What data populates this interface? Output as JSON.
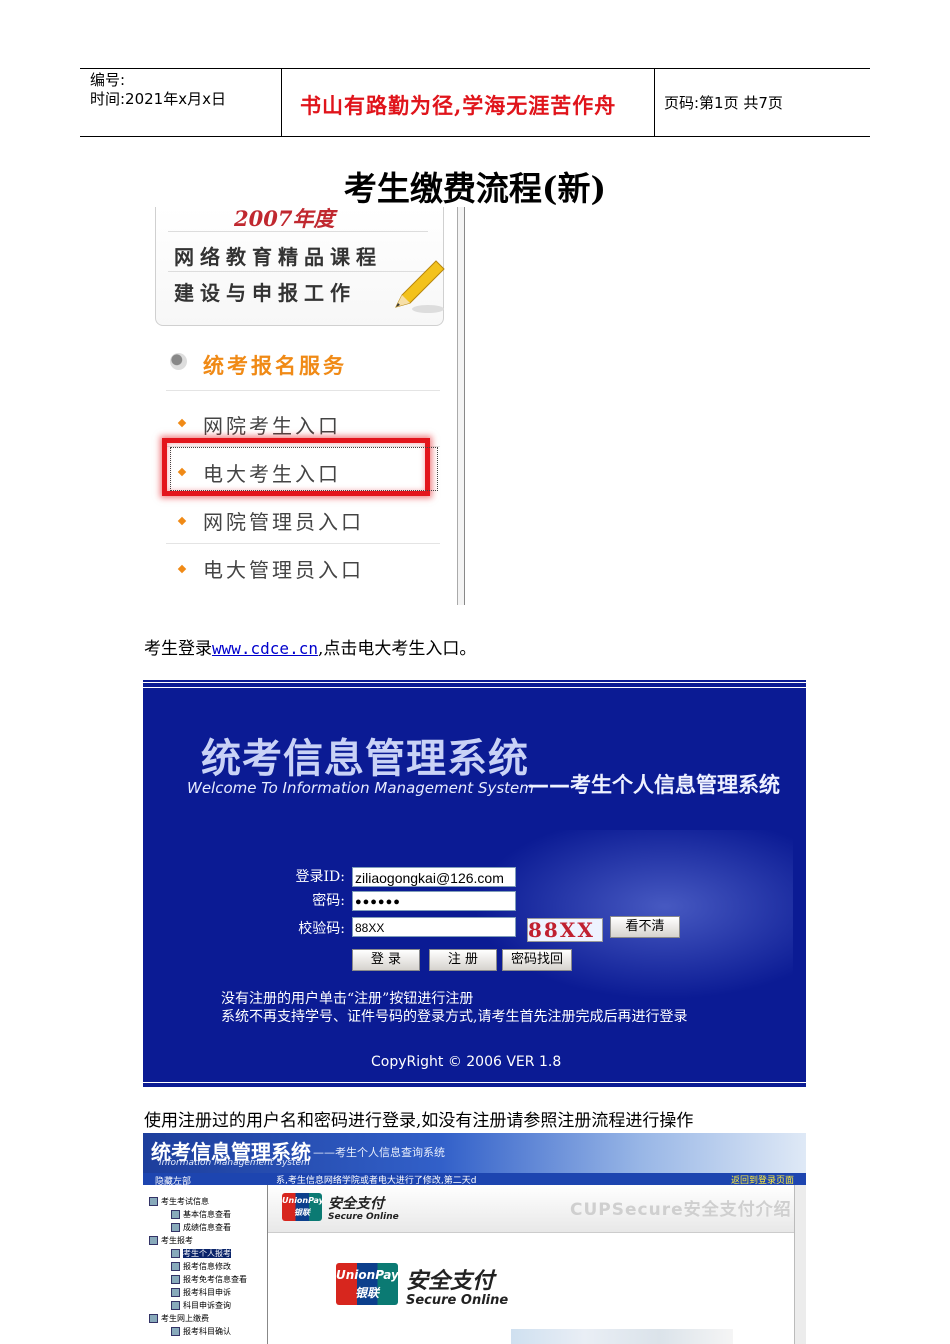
{
  "header": {
    "number_label": "编号:",
    "time_label": "时间:2021年x月x日",
    "motto": "书山有路勤为径,学海无涯苦作舟",
    "page_label": "页码:第1页 共7页"
  },
  "document": {
    "title": "考生缴费流程(新)",
    "caption1_before": "考生登录",
    "caption1_link": "www.cdce.cn",
    "caption1_after": ",点击电大考生入口。",
    "caption2": "使用注册过的用户名和密码进行登录,如没有注册请参照注册流程进行操作"
  },
  "side_menu": {
    "banner_year": "2007年度",
    "banner_line1": "网络教育精品课程",
    "banner_line2": "建设与申报工作",
    "service_title": "统考报名服务",
    "items": [
      "网院考生入口",
      "电大考生入口",
      "网院管理员入口",
      "电大管理员入口"
    ],
    "highlighted_index": 1,
    "highlight_color": "#e3151c",
    "accent_color": "#f08a16"
  },
  "login": {
    "title": "统考信息管理系统",
    "subtitle_en": "Welcome  To Information  Management  System",
    "subtitle_cn": "——考生个人信息管理系统",
    "id_label": "登录ID:",
    "id_value": "ziliaogongkai@126.com",
    "password_label": "密码:",
    "password_value": "●●●●●●",
    "code_label": "校验码:",
    "code_value": "88XX",
    "captcha_text": "88XX",
    "unclear_button": "看不清",
    "login_button": "登 录",
    "register_button": "注 册",
    "recover_button": "密码找回",
    "note1": "没有注册的用户单击“注册”按钮进行注册",
    "note2": "系统不再支持学号、证件号码的登录方式,请考生首先注册完成后再进行登录",
    "copyright": "CopyRight © 2006  VER 1.8",
    "background_color": "#0b1b94"
  },
  "payment_system": {
    "title": "统考信息管理系统",
    "title_sub": "——考生个人信息查询系统",
    "title_en": "Information  Management  System",
    "bar_left": "隐藏左部",
    "bar_notice": "系,考生信息网络学院或者电大进行了修改,第二天d",
    "bar_right": "返回到登录页面",
    "tree": [
      {
        "label": "考生考试信息",
        "level": 0
      },
      {
        "label": "基本信息查看",
        "level": 1
      },
      {
        "label": "成绩信息查看",
        "level": 1
      },
      {
        "label": "考生报考",
        "level": 0
      },
      {
        "label": "考生个人报考",
        "level": 1,
        "selected": true
      },
      {
        "label": "报考信息修改",
        "level": 1
      },
      {
        "label": "报考免考信息查看",
        "level": 1
      },
      {
        "label": "报考科目申诉",
        "level": 1
      },
      {
        "label": "科目申诉查询",
        "level": 1
      },
      {
        "label": "考生网上缴费",
        "level": 0
      },
      {
        "label": "报考科目确认",
        "level": 1
      }
    ],
    "unionpay_logo": "UnionPay 银联",
    "secure_cn": "安全支付",
    "secure_en": "Secure Online",
    "cupsecure": "CUPSecure安全支付介绍"
  }
}
